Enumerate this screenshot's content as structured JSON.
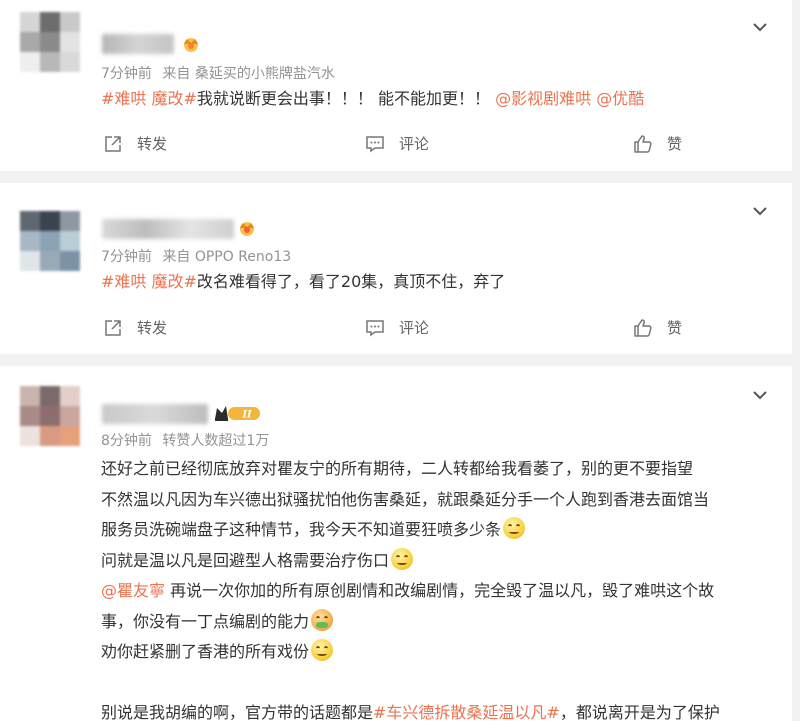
{
  "comments": [
    {
      "time": "7分钟前",
      "source": "来自 桑延买的小熊牌盐汽水",
      "text": {
        "tag": "#难哄 魔改#",
        "content": "我就说断更会出事！！！ 能不能加更！！",
        "mention1": "@影视剧难哄",
        "mention2": "@优酷"
      },
      "repost_label": "转发",
      "comment_label": "评论",
      "like_label": "赞",
      "badge_icon": "crown-badge-icon"
    },
    {
      "time": "7分钟前",
      "source": "来自 OPPO Reno13",
      "text": {
        "tag": "#难哄 魔改#",
        "content": "改名难看得了，看了20集，真顶不住，弃了"
      },
      "repost_label": "转发",
      "comment_label": "评论",
      "like_label": "赞",
      "badge_icon": "crown-badge-icon"
    },
    {
      "time": "8分钟前",
      "repost_info": "转赞人数超过1万",
      "badge_icon": "crown-level-badge-icon",
      "badge_level": "II",
      "lines": {
        "l1": "还好之前已经彻底放弃对瞿友宁的所有期待，二人转都给我看萎了，别的更不要指望",
        "l2": "不然温以凡因为车兴德出狱骚扰怕他伤害桑延，就跟桑延分手一个人跑到香港去面馆当",
        "l3": "服务员洗碗端盘子这种情节，我今天不知道要狂喷多少条",
        "l4": "问就是温以凡是回避型人格需要治疗伤口",
        "l5_mention": "@瞿友寧",
        "l5": " 再说一次你加的所有原创剧情和改编剧情，完全毁了温以凡，毁了难哄这个故",
        "l6": "事，你没有一丁点编剧的能力",
        "l7": "劝你赶紧删了香港的所有戏份",
        "l9a": "别说是我胡编的啊，官方带的话题都是",
        "l9_tag": "#车兴德拆散桑延温以凡#",
        "l9b": "，都说离开是为了保护"
      }
    }
  ],
  "colors": {
    "accent": "#eb7350",
    "meta": "#939393",
    "action": "#636363",
    "background": "#f2f2f2"
  }
}
